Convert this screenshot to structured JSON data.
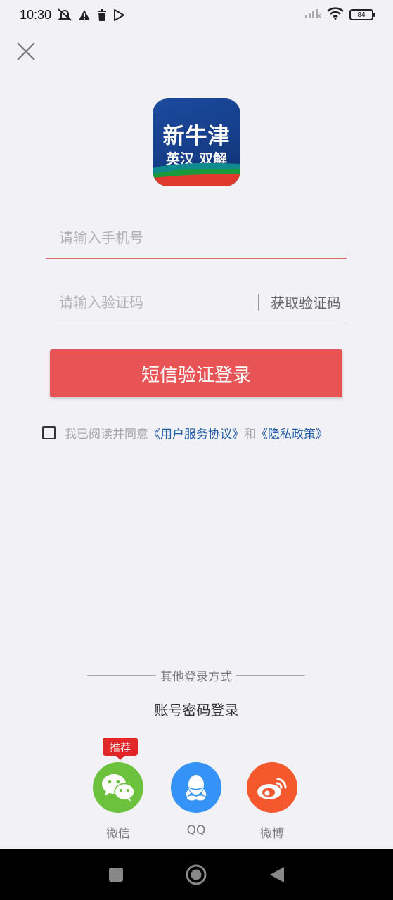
{
  "status_bar": {
    "time": "10:30",
    "battery": "84",
    "icons": [
      "mute-icon",
      "warning-icon",
      "trash-icon",
      "play-store-icon",
      "signal-icon",
      "wifi-icon",
      "battery-icon"
    ]
  },
  "logo": {
    "line1": "新牛津",
    "line2": "英汉 双解"
  },
  "form": {
    "phone_placeholder": "请输入手机号",
    "code_placeholder": "请输入验证码",
    "get_code_label": "获取验证码",
    "submit_label": "短信验证登录"
  },
  "agreement": {
    "prefix": "我已阅读并同意",
    "terms_link": "《用户服务协议》",
    "conjunction": "和",
    "privacy_link": "《隐私政策》"
  },
  "other_login": {
    "title": "其他登录方式",
    "password_login": "账号密码登录",
    "badge": "推荐",
    "providers": [
      {
        "label": "微信",
        "icon": "wechat-icon"
      },
      {
        "label": "QQ",
        "icon": "qq-icon"
      },
      {
        "label": "微博",
        "icon": "weibo-icon"
      }
    ]
  },
  "colors": {
    "accent": "#e85456",
    "link": "#1f5aa8",
    "background": "#f2f1f6",
    "wechat": "#6cc23c",
    "qq": "#3592f7",
    "weibo": "#f4582c"
  }
}
